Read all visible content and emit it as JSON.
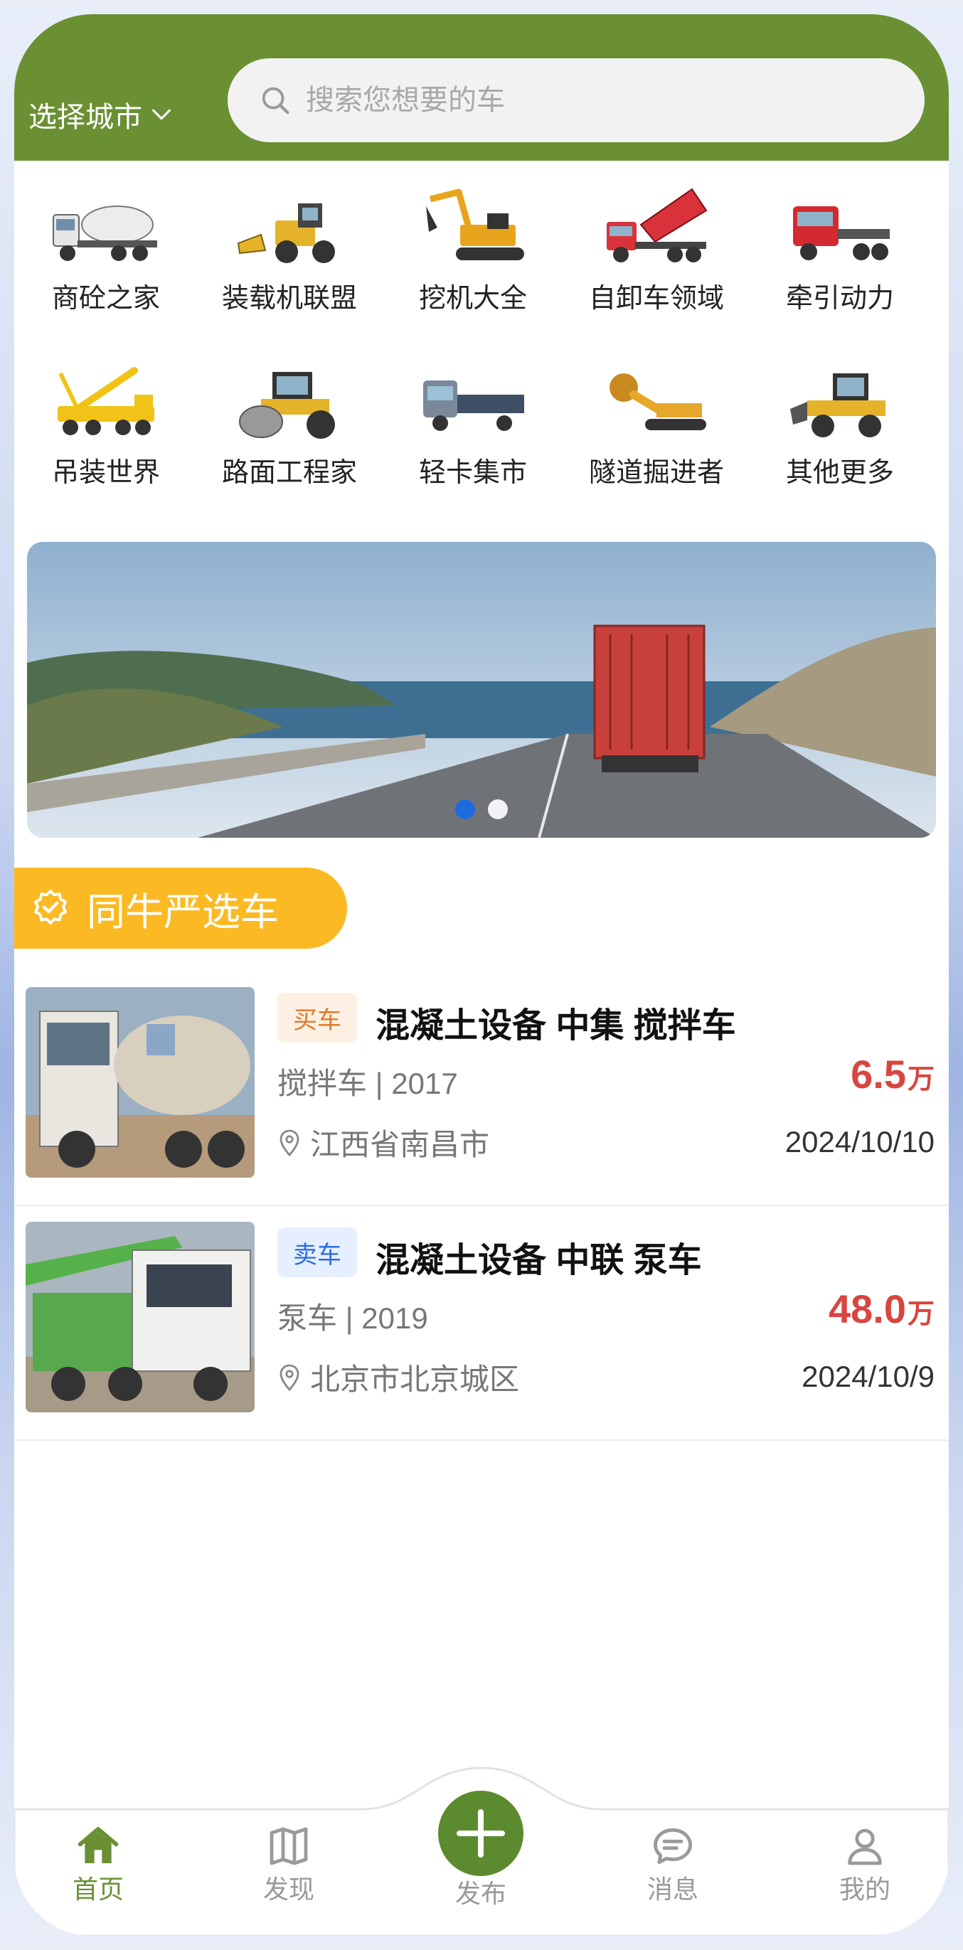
{
  "header": {
    "city_label": "选择城市",
    "search_placeholder": "搜索您想要的车"
  },
  "categories": [
    {
      "label": "商砼之家",
      "icon": "mixer-truck-icon"
    },
    {
      "label": "装载机联盟",
      "icon": "loader-icon"
    },
    {
      "label": "挖机大全",
      "icon": "excavator-icon"
    },
    {
      "label": "自卸车领域",
      "icon": "dump-truck-icon"
    },
    {
      "label": "牵引动力",
      "icon": "tractor-truck-icon"
    },
    {
      "label": "吊装世界",
      "icon": "crane-truck-icon"
    },
    {
      "label": "路面工程家",
      "icon": "road-roller-icon"
    },
    {
      "label": "轻卡集市",
      "icon": "light-truck-icon"
    },
    {
      "label": "隧道掘进者",
      "icon": "tunnel-boring-icon"
    },
    {
      "label": "其他更多",
      "icon": "more-machinery-icon"
    }
  ],
  "banner": {
    "slides": 2,
    "active_slide": 1
  },
  "section": {
    "title": "同牛严选车"
  },
  "listings": [
    {
      "tag": "买车",
      "title": "混凝土设备 中集 搅拌车",
      "spec": "搅拌车 | 2017",
      "price": "6.5",
      "unit": "万",
      "location": "江西省南昌市",
      "date": "2024/10/10"
    },
    {
      "tag": "卖车",
      "title": "混凝土设备 中联 泵车",
      "spec": "泵车 | 2019",
      "price": "48.0",
      "unit": "万",
      "location": "北京市北京城区",
      "date": "2024/10/9"
    }
  ],
  "tabbar": {
    "home": "首页",
    "discover": "发现",
    "publish": "发布",
    "messages": "消息",
    "mine": "我的"
  },
  "colors": {
    "brand_green": "#6a9033",
    "accent_yellow": "#fbba23",
    "price_red": "#d9453f",
    "buy_tag": "#e27a2c",
    "sell_tag": "#2a6ee3"
  }
}
